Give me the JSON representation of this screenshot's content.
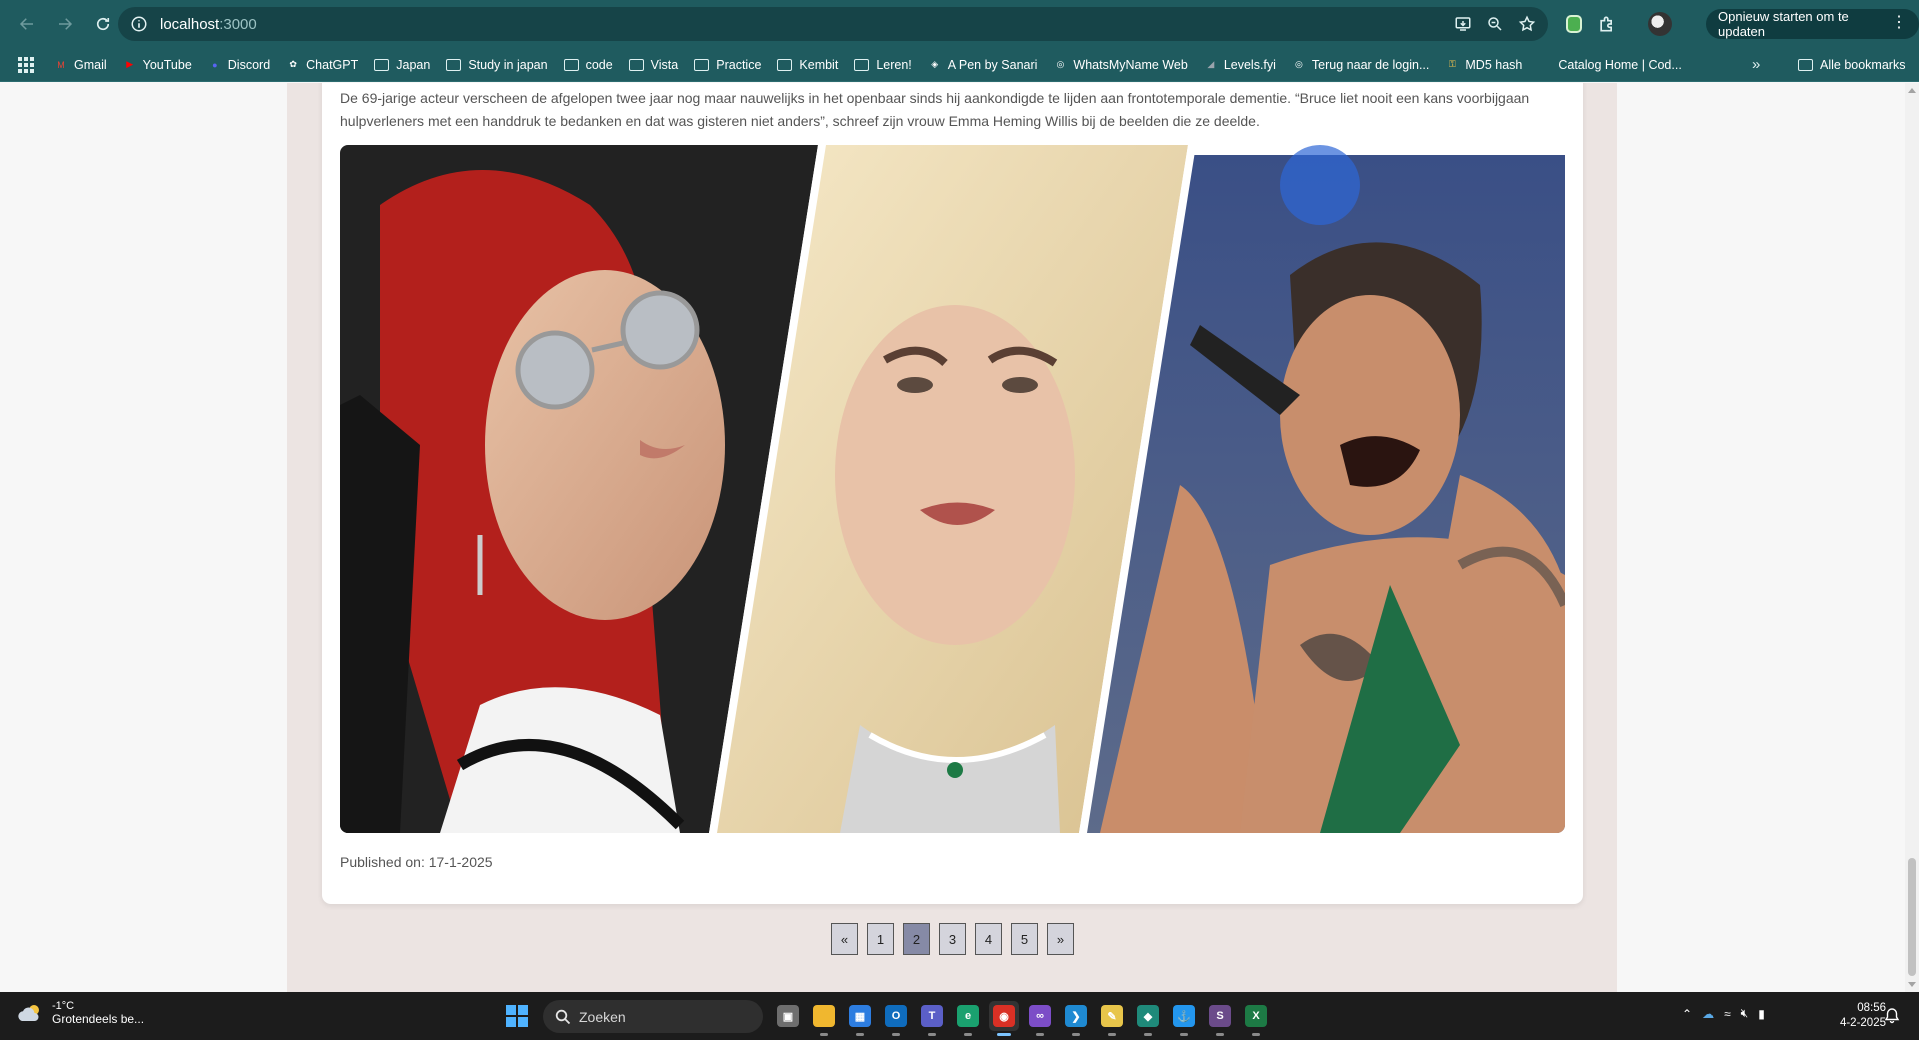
{
  "browser": {
    "url_host": "localhost",
    "url_port": ":3000",
    "update_button": "Opnieuw starten om te updaten",
    "bookmarks": [
      {
        "label": "Gmail",
        "icon": "gmail-icon",
        "color": "#ea4335",
        "glyph": "M",
        "folder": false
      },
      {
        "label": "YouTube",
        "icon": "youtube-icon",
        "color": "#ff0000",
        "glyph": "▶",
        "folder": false
      },
      {
        "label": "Discord",
        "icon": "discord-icon",
        "color": "#5865f2",
        "glyph": "●",
        "folder": false
      },
      {
        "label": "ChatGPT",
        "icon": "chatgpt-icon",
        "color": "#ffffff",
        "glyph": "✿",
        "folder": false
      },
      {
        "label": "Japan",
        "icon": "folder-icon",
        "folder": true
      },
      {
        "label": "Study in japan",
        "icon": "folder-icon",
        "folder": true
      },
      {
        "label": "code",
        "icon": "folder-icon",
        "folder": true
      },
      {
        "label": "Vista",
        "icon": "folder-icon",
        "folder": true
      },
      {
        "label": "Practice",
        "icon": "folder-icon",
        "folder": true
      },
      {
        "label": "Kembit",
        "icon": "folder-icon",
        "folder": true
      },
      {
        "label": "Leren!",
        "icon": "folder-icon",
        "folder": true
      },
      {
        "label": "A Pen by Sanari",
        "icon": "codepen-icon",
        "color": "#ffffff",
        "glyph": "◈",
        "folder": false
      },
      {
        "label": "WhatsMyName Web",
        "icon": "globe-icon",
        "color": "#ffffff",
        "glyph": "◎",
        "folder": false
      },
      {
        "label": "Levels.fyi",
        "icon": "levels-icon",
        "color": "#9aa4ad",
        "glyph": "◢",
        "folder": false
      },
      {
        "label": "Terug naar de login...",
        "icon": "globe-icon",
        "color": "#ffffff",
        "glyph": "◎",
        "folder": false
      },
      {
        "label": "MD5 hash",
        "icon": "key-icon",
        "color": "#f2c14e",
        "glyph": "⚿",
        "folder": false
      },
      {
        "label": "Catalog Home | Cod...",
        "icon": "catalog-icon",
        "color": "#1f5b5f",
        "glyph": "",
        "folder": false
      }
    ],
    "all_bookmarks": "Alle bookmarks"
  },
  "article": {
    "text": "De 69-jarige acteur verscheen de afgelopen twee jaar nog maar nauwelijks in het openbaar sinds hij aankondigde te lijden aan frontotemporale dementie. “Bruce liet nooit een kans voorbijgaan hulpverleners met een handdruk te bedanken en dat was gisteren niet anders”, schreef zijn vrouw Emma Heming Willis bij de beelden die ze deelde.",
    "published": "Published on: 17-1-2025"
  },
  "pagination": {
    "prev": "«",
    "next": "»",
    "pages": [
      "1",
      "2",
      "3",
      "4",
      "5"
    ],
    "current": "2"
  },
  "taskbar": {
    "temperature": "-1°C",
    "weather_desc": "Grotendeels be...",
    "search_placeholder": "Zoeken",
    "time": "08:56",
    "date": "4-2-2025",
    "apps": [
      {
        "name": "task-view-icon",
        "color": "#6e6e6e",
        "glyph": "▣"
      },
      {
        "name": "file-explorer-icon",
        "color": "#f0b72f",
        "glyph": ""
      },
      {
        "name": "store-icon",
        "color": "#2d7de0",
        "glyph": "▦"
      },
      {
        "name": "outlook-icon",
        "color": "#0f6cbd",
        "glyph": "O"
      },
      {
        "name": "teams-icon",
        "color": "#5b5fc7",
        "glyph": "T"
      },
      {
        "name": "edge-icon",
        "color": "#1aa16f",
        "glyph": "e"
      },
      {
        "name": "chrome-icon",
        "color": "#d93025",
        "glyph": "◉"
      },
      {
        "name": "visual-studio-icon",
        "color": "#7c4dc7",
        "glyph": "∞"
      },
      {
        "name": "vscode-icon",
        "color": "#1f8ad2",
        "glyph": "❯"
      },
      {
        "name": "sticky-notes-icon",
        "color": "#e8c54a",
        "glyph": "✎"
      },
      {
        "name": "app-green-icon",
        "color": "#1f8a7a",
        "glyph": "◆"
      },
      {
        "name": "docker-icon",
        "color": "#2396ed",
        "glyph": "⚓"
      },
      {
        "name": "ssms-icon",
        "color": "#6b4b8a",
        "glyph": "S"
      },
      {
        "name": "excel-icon",
        "color": "#1d7a45",
        "glyph": "X"
      }
    ]
  }
}
